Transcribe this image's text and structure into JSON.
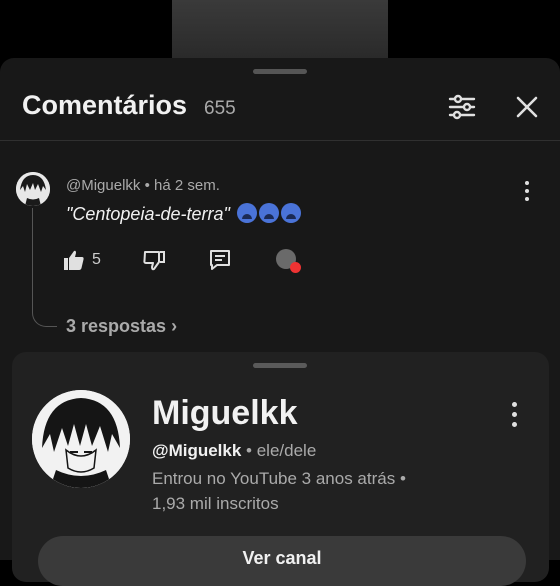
{
  "sheet": {
    "title": "Comentários",
    "count": "655"
  },
  "comment": {
    "meta": "@Miguelkk • há 2 sem.",
    "text": "\"Centopeia-de-terra\"",
    "likes": "5",
    "replies": "3 respostas"
  },
  "profile": {
    "name": "Miguelkk",
    "handle": "@Miguelkk",
    "pronouns": " • ele/dele",
    "joined": "Entrou no YouTube 3 anos atrás •",
    "subscribers": "1,93 mil inscritos",
    "channel_button": "Ver canal"
  },
  "icons": {
    "filter": "filter-sliders-icon",
    "close": "close-icon",
    "like": "thumb-up-icon",
    "dislike": "thumb-down-icon",
    "reply": "reply-comment-icon",
    "more": "more-vertical-icon"
  }
}
